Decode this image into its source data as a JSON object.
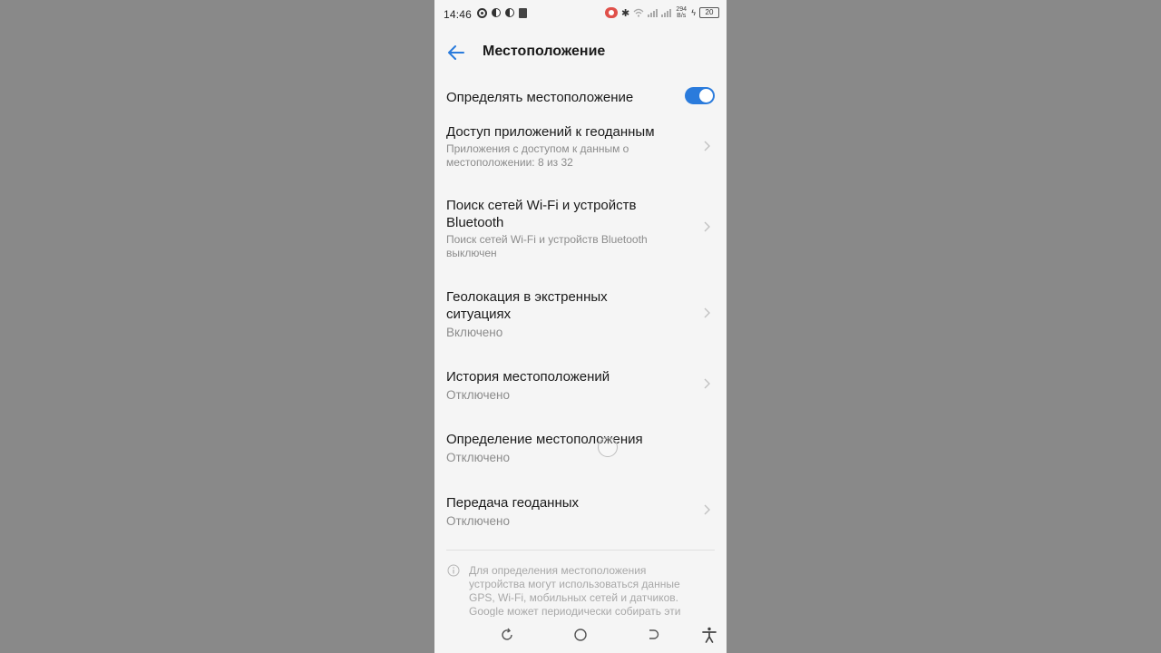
{
  "status_bar": {
    "time": "14:46",
    "speed_value": "294",
    "speed_unit": "B/s",
    "battery": "20"
  },
  "header": {
    "back_icon": "arrow-left-icon",
    "title": "Местоположение",
    "accent_color": "#2a7bdc"
  },
  "location_toggle": {
    "label": "Определять местоположение",
    "state": "on"
  },
  "items": [
    {
      "title": "Доступ приложений к геоданным",
      "subtitle": "Приложения с доступом к данным о местоположении: 8 из 32"
    },
    {
      "title": "Поиск сетей Wi-Fi и устройств Bluetooth",
      "subtitle": "Поиск сетей Wi-Fi и устройств Bluetooth выключен"
    },
    {
      "title": "Геолокация в экстренных ситуациях",
      "subtitle": "Включено"
    },
    {
      "title": "История местоположений",
      "subtitle": "Отключено"
    },
    {
      "title": "Определение местоположения",
      "subtitle": "Отключено"
    },
    {
      "title": "Передача геоданных",
      "subtitle": "Отключено"
    }
  ],
  "footer_note": "Для определения местоположения устройства могут использоваться данные GPS, Wi-Fi, мобильных сетей и датчиков. Google может периодически собирать эти"
}
